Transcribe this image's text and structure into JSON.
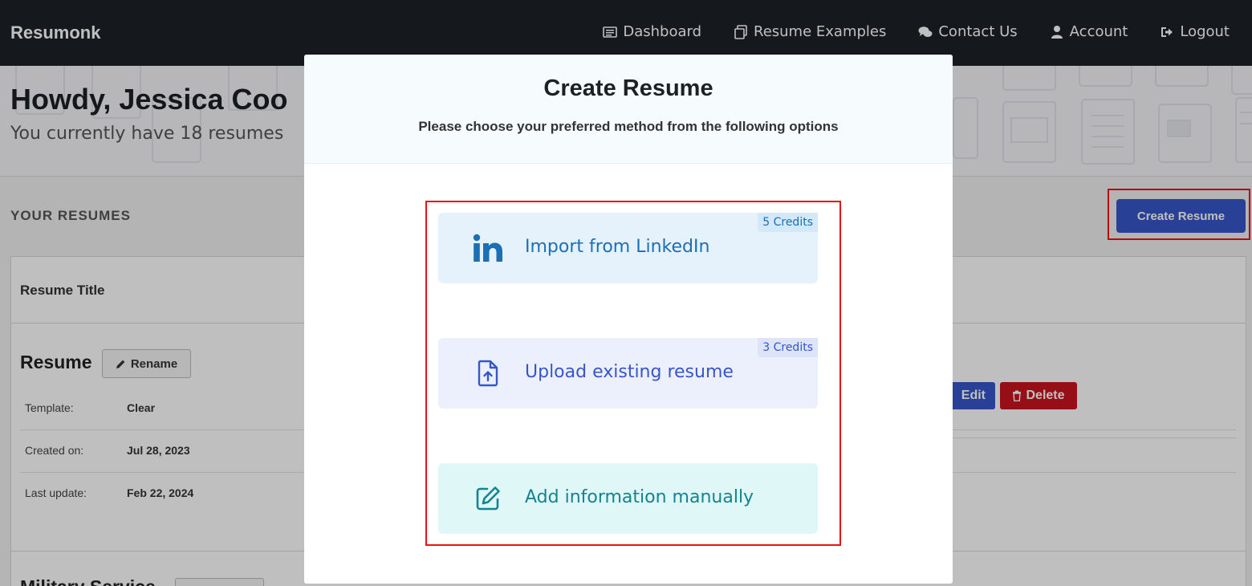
{
  "app": {
    "brand": "Resumonk"
  },
  "nav": {
    "items": [
      {
        "label": "Dashboard",
        "icon": "list-icon"
      },
      {
        "label": "Resume Examples",
        "icon": "copy-icon"
      },
      {
        "label": "Contact Us",
        "icon": "chat-icon"
      },
      {
        "label": "Account",
        "icon": "user-icon"
      },
      {
        "label": "Logout",
        "icon": "logout-icon"
      }
    ]
  },
  "hero": {
    "greeting": "Howdy, Jessica Coo",
    "subtitle": "You currently have 18 resumes"
  },
  "resumes": {
    "section_label": "YOUR RESUMES",
    "create_label": "Create Resume",
    "column_header": "Resume Title",
    "first": {
      "name": "Resume",
      "rename_label": "Rename",
      "template_label": "Template:",
      "template_value": "Clear",
      "created_label": "Created on:",
      "created_value": "Jul 28, 2023",
      "updated_label": "Last update:",
      "updated_value": "Feb 22, 2024",
      "edit_label": "Edit",
      "delete_label": "Delete"
    },
    "second": {
      "name": "Military Service"
    }
  },
  "modal": {
    "title": "Create Resume",
    "subtitle": "Please choose your preferred method from the following options",
    "options": [
      {
        "label": "Import from LinkedIn",
        "credits": "5 Credits",
        "icon": "linkedin-icon"
      },
      {
        "label": "Upload existing resume",
        "credits": "3 Credits",
        "icon": "file-upload-icon"
      },
      {
        "label": "Add information manually",
        "icon": "edit-icon"
      }
    ]
  },
  "colors": {
    "nav_bg": "#1c2227",
    "primary": "#3656c9",
    "danger": "#c8141f",
    "linkedin": "#1a6fb5",
    "teal": "#16838e",
    "highlight": "#ee1111"
  }
}
